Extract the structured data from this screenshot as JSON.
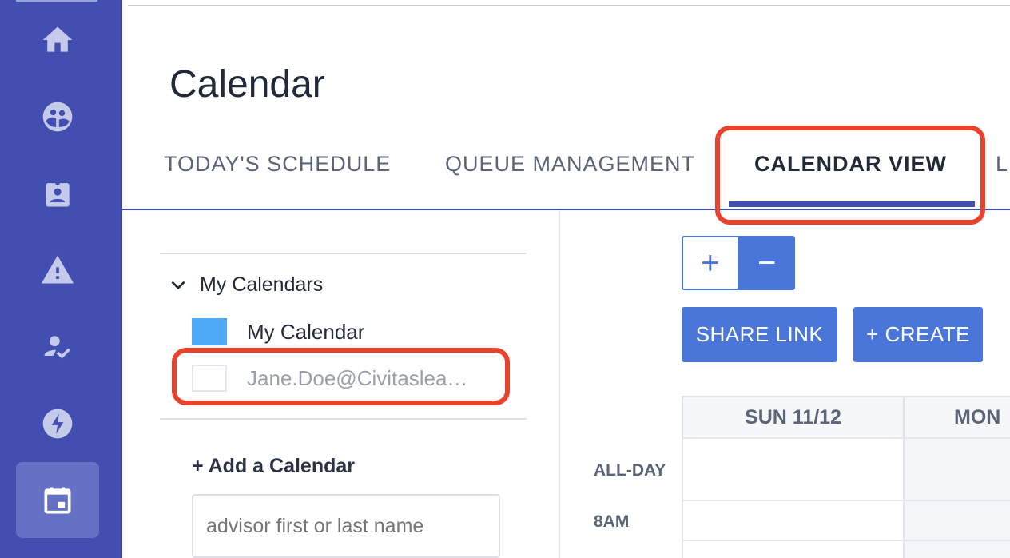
{
  "sidebar": {
    "items": [
      {
        "icon": "home-icon"
      },
      {
        "icon": "groups-icon"
      },
      {
        "icon": "badge-icon"
      },
      {
        "icon": "warning-icon"
      },
      {
        "icon": "person-check-icon"
      },
      {
        "icon": "lightning-icon"
      },
      {
        "icon": "calendar-icon",
        "active": true
      }
    ]
  },
  "header": {
    "title": "Calendar"
  },
  "tabs": [
    {
      "label": "TODAY'S SCHEDULE"
    },
    {
      "label": "QUEUE MANAGEMENT"
    },
    {
      "label": "CALENDAR VIEW",
      "active": true
    },
    {
      "label": "L"
    }
  ],
  "calendars": {
    "heading": "My Calendars",
    "items": [
      {
        "label": "My Calendar",
        "color": "#4dabf7",
        "checked": true
      },
      {
        "label": "Jane.Doe@Civitaslea…",
        "checked": false
      }
    ],
    "add_label": "+ Add a Calendar",
    "search_placeholder": "advisor first or last name"
  },
  "toolbar": {
    "zoom_in": "+",
    "zoom_out": "−",
    "share_label": "SHARE LINK",
    "create_label": "+ CREATE"
  },
  "grid": {
    "columns": [
      "SUN 11/12",
      "MON"
    ],
    "rows": [
      "ALL-DAY",
      "8AM"
    ]
  },
  "colors": {
    "sidebar": "#434fb0",
    "accent": "#4a76d9",
    "annotation": "#e8412c"
  }
}
